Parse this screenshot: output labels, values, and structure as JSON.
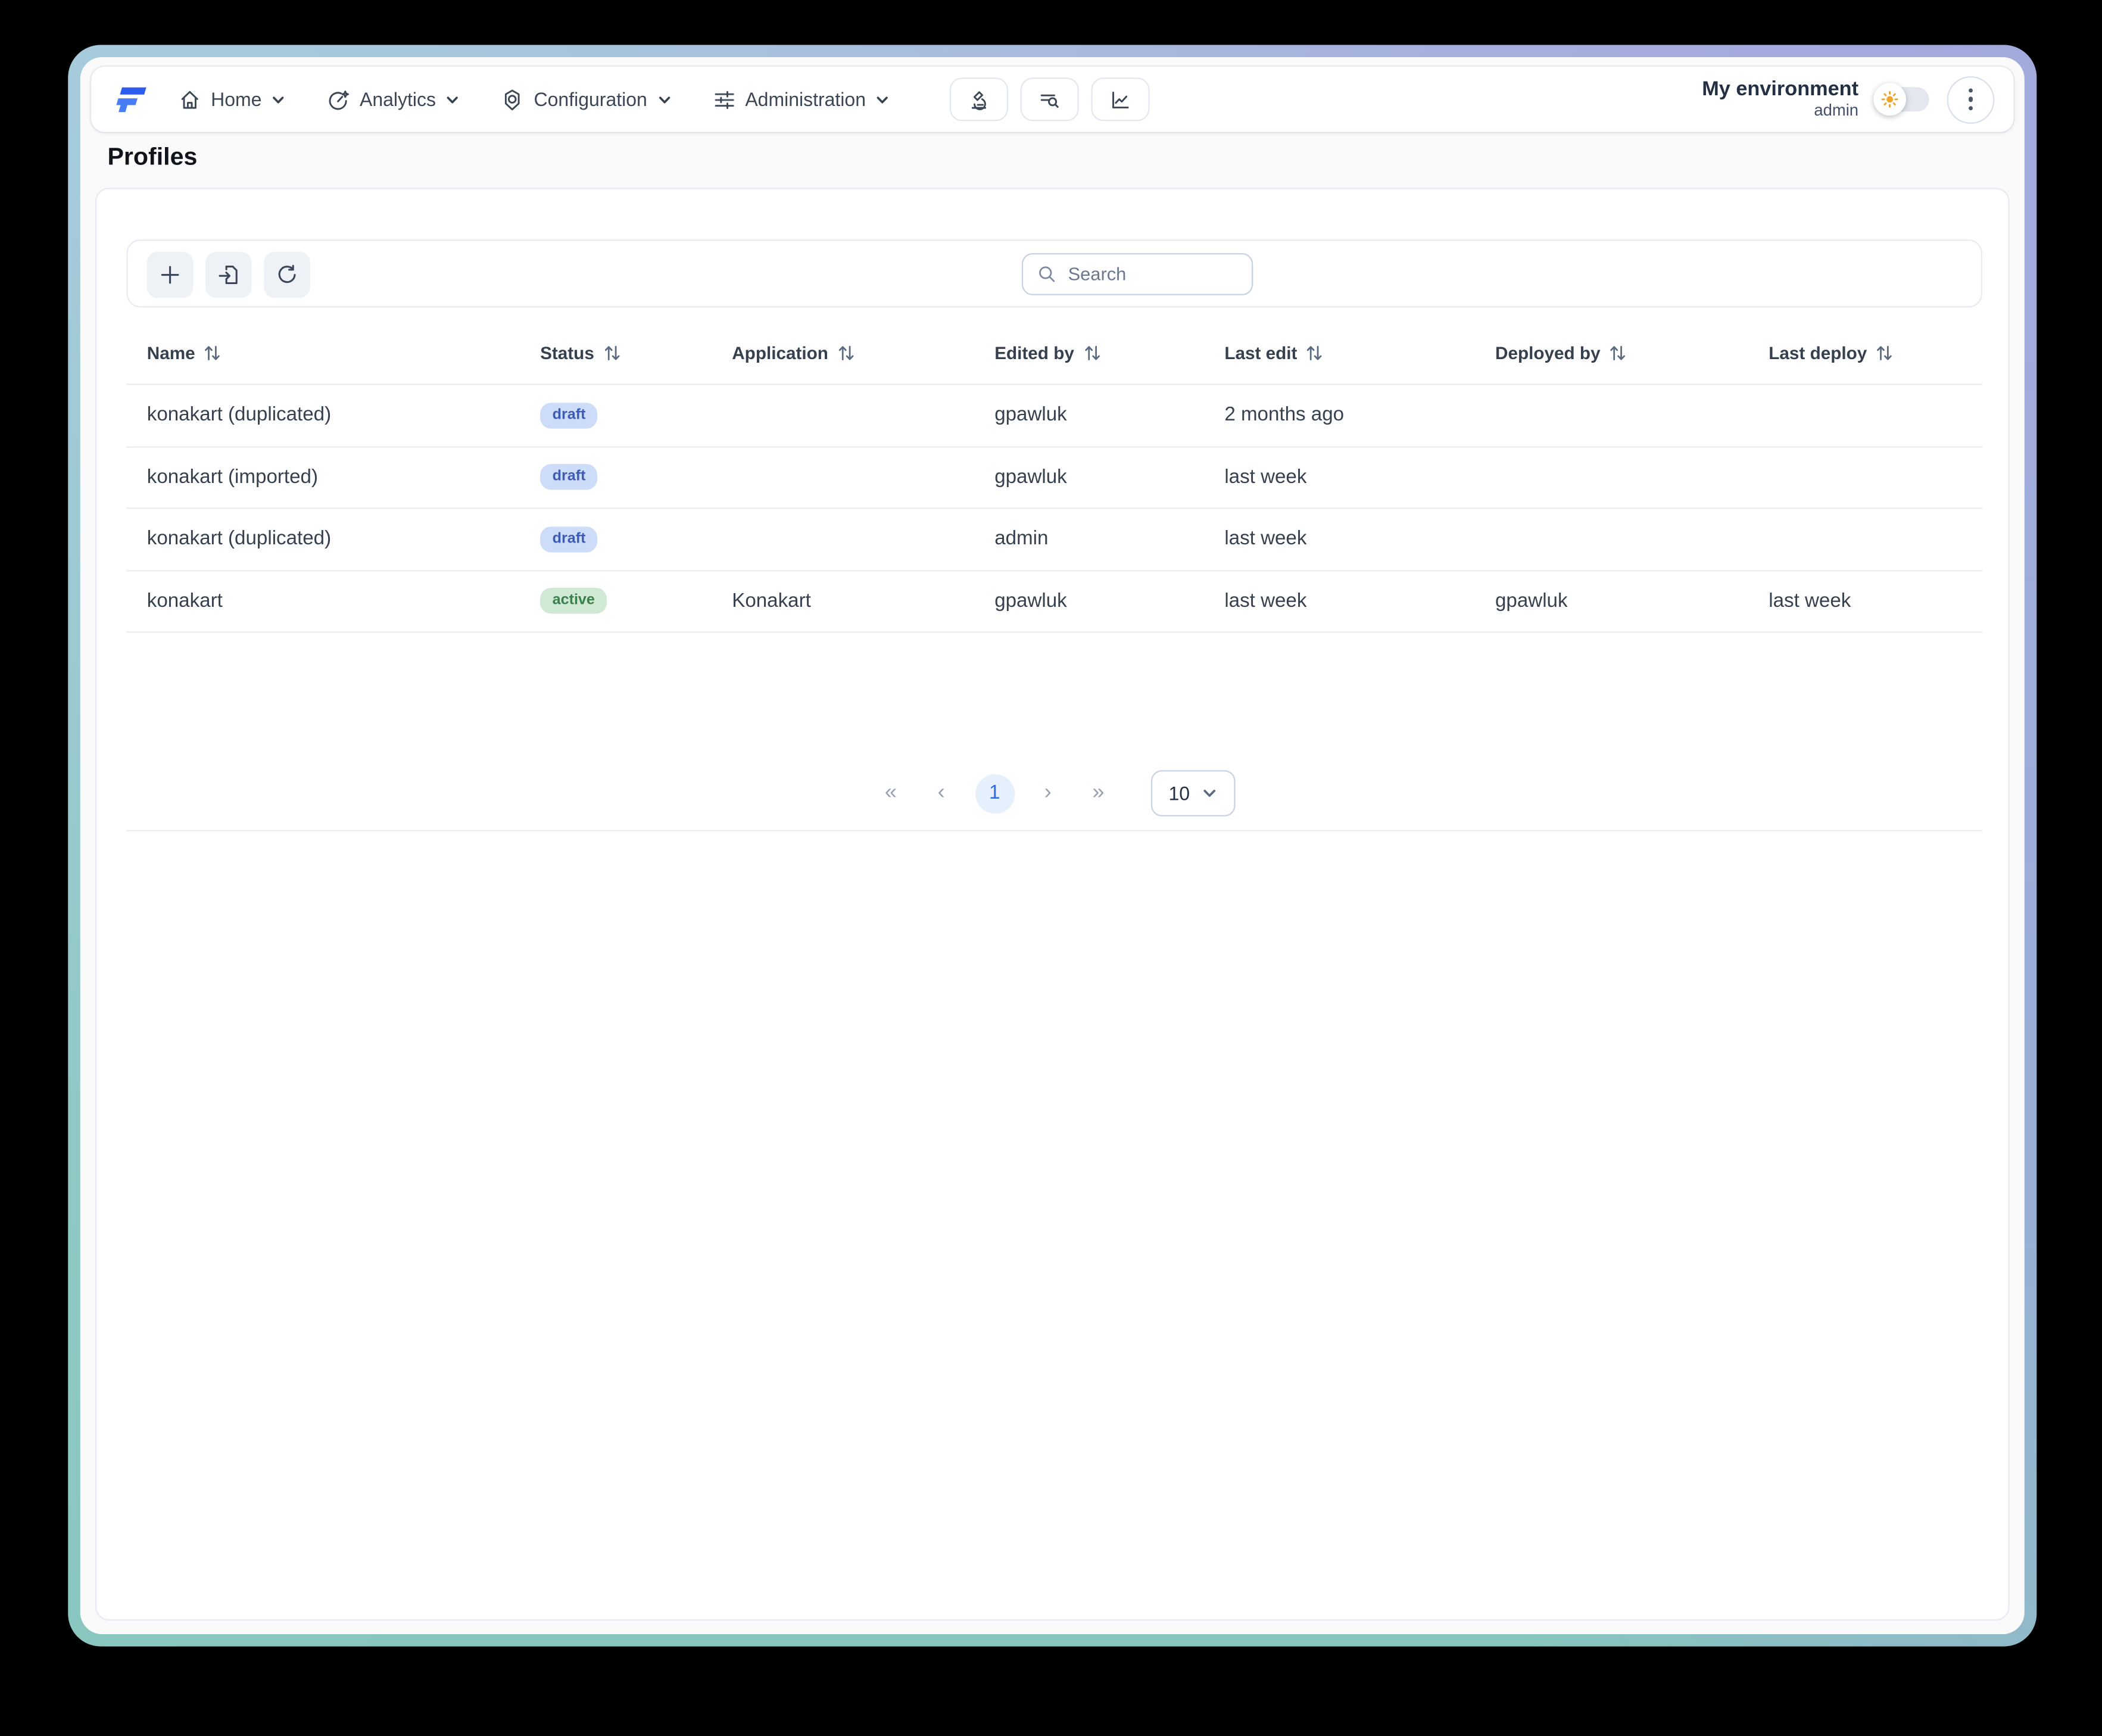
{
  "nav": {
    "items": [
      {
        "label": "Home",
        "icon": "home-icon"
      },
      {
        "label": "Analytics",
        "icon": "gauge-icon"
      },
      {
        "label": "Configuration",
        "icon": "badge-target-icon"
      },
      {
        "label": "Administration",
        "icon": "sliders-icon"
      }
    ],
    "action_icons": [
      "microscope-icon",
      "list-search-icon",
      "line-chart-icon"
    ],
    "environment": {
      "name": "My environment",
      "user": "admin"
    },
    "theme_toggle": {
      "state": "light",
      "icon": "sun-icon"
    }
  },
  "page": {
    "title": "Profiles"
  },
  "toolbar": {
    "buttons": [
      "add-icon",
      "import-icon",
      "refresh-icon"
    ],
    "search_placeholder": "Search"
  },
  "table": {
    "columns": [
      "Name",
      "Status",
      "Application",
      "Edited by",
      "Last edit",
      "Deployed by",
      "Last deploy"
    ],
    "rows": [
      {
        "name": "konakart (duplicated)",
        "status": "draft",
        "application": "",
        "edited_by": "gpawluk",
        "last_edit": "2 months ago",
        "deployed_by": "",
        "last_deploy": ""
      },
      {
        "name": "konakart (imported)",
        "status": "draft",
        "application": "",
        "edited_by": "gpawluk",
        "last_edit": "last week",
        "deployed_by": "",
        "last_deploy": ""
      },
      {
        "name": "konakart (duplicated)",
        "status": "draft",
        "application": "",
        "edited_by": "admin",
        "last_edit": "last week",
        "deployed_by": "",
        "last_deploy": ""
      },
      {
        "name": "konakart",
        "status": "active",
        "application": "Konakart",
        "edited_by": "gpawluk",
        "last_edit": "last week",
        "deployed_by": "gpawluk",
        "last_deploy": "last week"
      }
    ]
  },
  "pagination": {
    "first": "«",
    "prev": "‹",
    "current_page": "1",
    "next": "›",
    "last": "»",
    "page_size": "10"
  },
  "colors": {
    "accent_blue": "#2d5cf0",
    "badge_draft_bg": "#cdddf9",
    "badge_draft_text": "#3d5bb5",
    "badge_active_bg": "#cfe9d4",
    "badge_active_text": "#398049",
    "frame_top_left": "#a6cbdc",
    "frame_top_right": "#a4a9dd",
    "frame_bottom": "#86c6bc",
    "sun_orange": "#eca42c"
  }
}
